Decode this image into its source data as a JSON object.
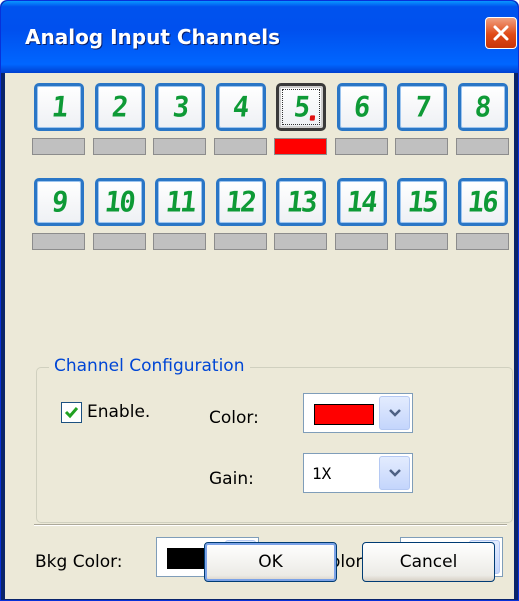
{
  "window": {
    "title": "Analog Input Channels",
    "close_icon": "close-x-icon"
  },
  "channels": [
    {
      "label": "1",
      "active": false
    },
    {
      "label": "2",
      "active": false
    },
    {
      "label": "3",
      "active": false
    },
    {
      "label": "4",
      "active": false
    },
    {
      "label": "5",
      "active": true,
      "selected": true
    },
    {
      "label": "6",
      "active": false
    },
    {
      "label": "7",
      "active": false
    },
    {
      "label": "8",
      "active": false
    },
    {
      "label": "9",
      "active": false
    },
    {
      "label": "10",
      "active": false
    },
    {
      "label": "11",
      "active": false
    },
    {
      "label": "12",
      "active": false
    },
    {
      "label": "13",
      "active": false
    },
    {
      "label": "14",
      "active": false
    },
    {
      "label": "15",
      "active": false
    },
    {
      "label": "16",
      "active": false
    }
  ],
  "channel_config": {
    "legend": "Channel Configuration",
    "enable_label": "Enable.",
    "enable_checked": true,
    "color_label": "Color:",
    "color_value": "#ff0000",
    "gain_label": "Gain:",
    "gain_value": "1X"
  },
  "display": {
    "bkg_label": "Bkg Color:",
    "bkg_value": "#000000",
    "grid_label": "Grid Color:",
    "grid_value": "#00ff00"
  },
  "buttons": {
    "ok": "OK",
    "cancel": "Cancel"
  },
  "colors": {
    "active_indicator": "#ff0000",
    "inactive_indicator": "#c0c0c0",
    "digit": "#0e9a36",
    "accent": "#0046d5"
  }
}
